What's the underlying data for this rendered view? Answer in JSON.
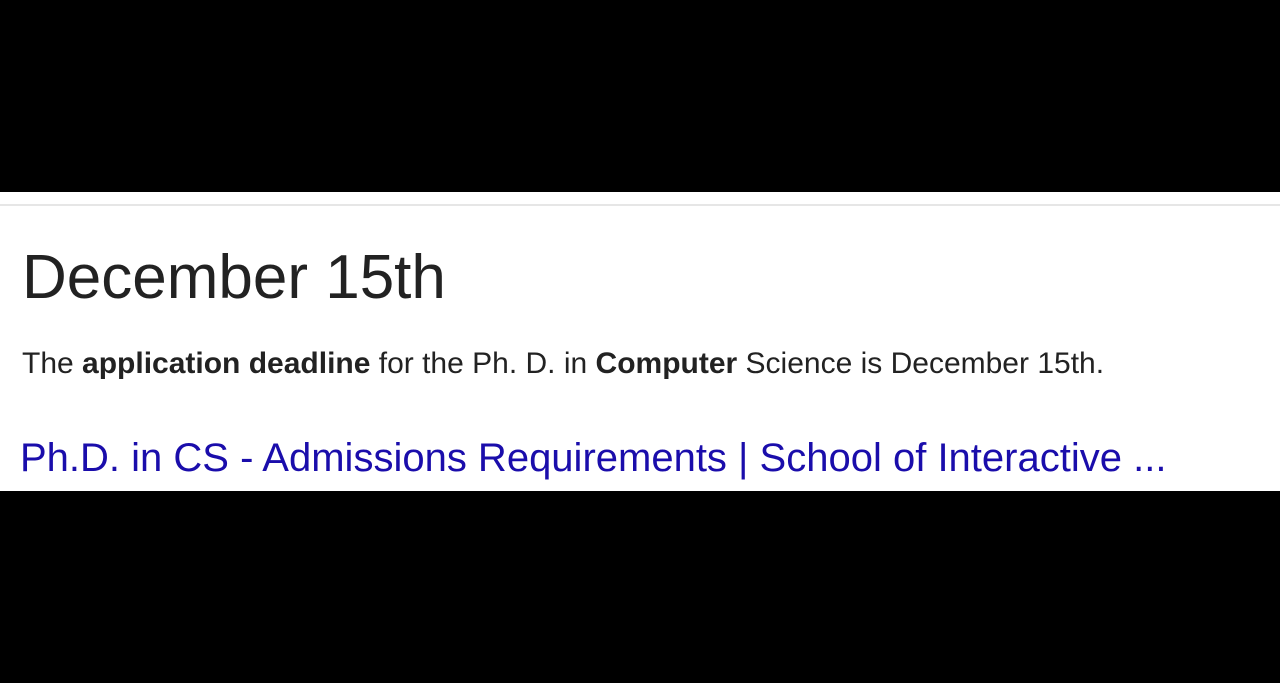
{
  "featured_snippet": {
    "answer": "December 15th",
    "description": {
      "part1": "The ",
      "bold1": "application deadline",
      "part2": " for the Ph. D. in ",
      "bold2": "Computer",
      "part3": " Science is December 15th."
    },
    "result_link_title": "Ph.D. in CS - Admissions Requirements | School of Interactive ..."
  },
  "colors": {
    "background_bars": "#000000",
    "panel": "#ffffff",
    "text": "#222222",
    "link": "#1a0dab",
    "divider": "#e6e6e6"
  }
}
